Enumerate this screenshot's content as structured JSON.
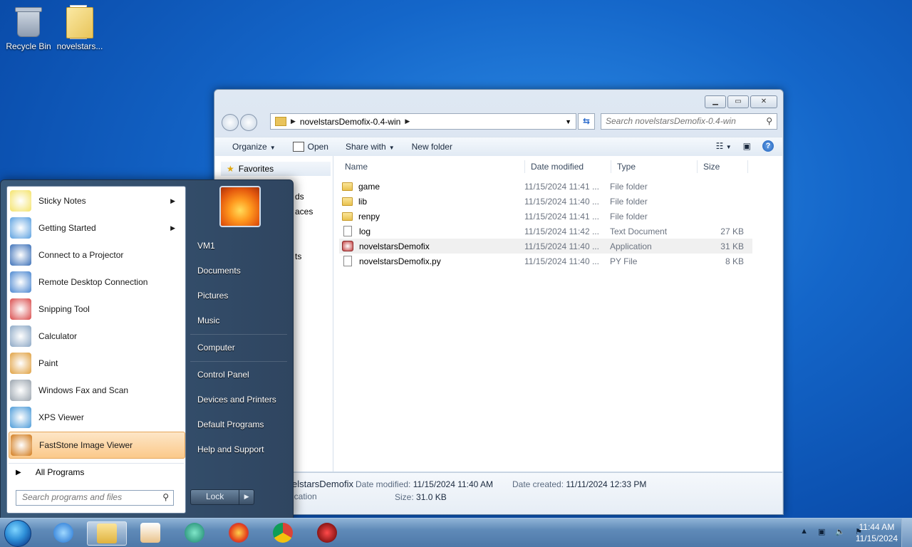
{
  "desktop": {
    "icons": [
      {
        "label": "Recycle Bin"
      },
      {
        "label": "novelstars..."
      }
    ]
  },
  "explorer": {
    "address": "novelstarsDemofix-0.4-win",
    "search_placeholder": "Search novelstarsDemofix-0.4-win",
    "toolbar": {
      "organize": "Organize",
      "open": "Open",
      "share_with": "Share with",
      "new_folder": "New folder"
    },
    "nav": {
      "favorites": "Favorites",
      "partial1": "ds",
      "partial2": "aces",
      "partial3": "ts"
    },
    "columns": {
      "name": "Name",
      "date": "Date modified",
      "type": "Type",
      "size": "Size"
    },
    "files": [
      {
        "name": "game",
        "date": "11/15/2024 11:41 ...",
        "type": "File folder",
        "size": "",
        "icon": "folder-icon"
      },
      {
        "name": "lib",
        "date": "11/15/2024 11:40 ...",
        "type": "File folder",
        "size": "",
        "icon": "folder-icon"
      },
      {
        "name": "renpy",
        "date": "11/15/2024 11:41 ...",
        "type": "File folder",
        "size": "",
        "icon": "folder-icon"
      },
      {
        "name": "log",
        "date": "11/15/2024 11:42 ...",
        "type": "Text Document",
        "size": "27 KB",
        "icon": "text-file-icon"
      },
      {
        "name": "novelstarsDemofix",
        "date": "11/15/2024 11:40 ...",
        "type": "Application",
        "size": "31 KB",
        "icon": "application-icon"
      },
      {
        "name": "novelstarsDemofix.py",
        "date": "11/15/2024 11:40 ...",
        "type": "PY File",
        "size": "8 KB",
        "icon": "py-file-icon"
      }
    ],
    "details": {
      "name": "elstarsDemofix",
      "kind": "ication",
      "date_modified_label": "Date modified:",
      "date_modified": "11/15/2024 11:40 AM",
      "date_created_label": "Date created:",
      "date_created": "11/11/2024 12:33 PM",
      "size_label": "Size:",
      "size": "31.0 KB"
    }
  },
  "start_menu": {
    "programs": [
      {
        "label": "Sticky Notes",
        "submenu": true,
        "color": "#f4e36a"
      },
      {
        "label": "Getting Started",
        "submenu": true,
        "color": "#5aa0e0"
      },
      {
        "label": "Connect to a Projector",
        "submenu": false,
        "color": "#3a6fb7"
      },
      {
        "label": "Remote Desktop Connection",
        "submenu": false,
        "color": "#4a86d0"
      },
      {
        "label": "Snipping Tool",
        "submenu": false,
        "color": "#d94a4a"
      },
      {
        "label": "Calculator",
        "submenu": false,
        "color": "#8aa6c4"
      },
      {
        "label": "Paint",
        "submenu": false,
        "color": "#e0a040"
      },
      {
        "label": "Windows Fax and Scan",
        "submenu": false,
        "color": "#9aa4ae"
      },
      {
        "label": "XPS Viewer",
        "submenu": false,
        "color": "#4a9ad8"
      },
      {
        "label": "FastStone Image Viewer",
        "submenu": false,
        "color": "#d27a1a"
      }
    ],
    "all_programs": "All Programs",
    "search_placeholder": "Search programs and files",
    "right_links": [
      "VM1",
      "Documents",
      "Pictures",
      "Music",
      "Computer",
      "Control Panel",
      "Devices and Printers",
      "Default Programs",
      "Help and Support"
    ],
    "lock": "Lock"
  },
  "taskbar": {
    "time": "11:44 AM",
    "date": "11/15/2024"
  }
}
